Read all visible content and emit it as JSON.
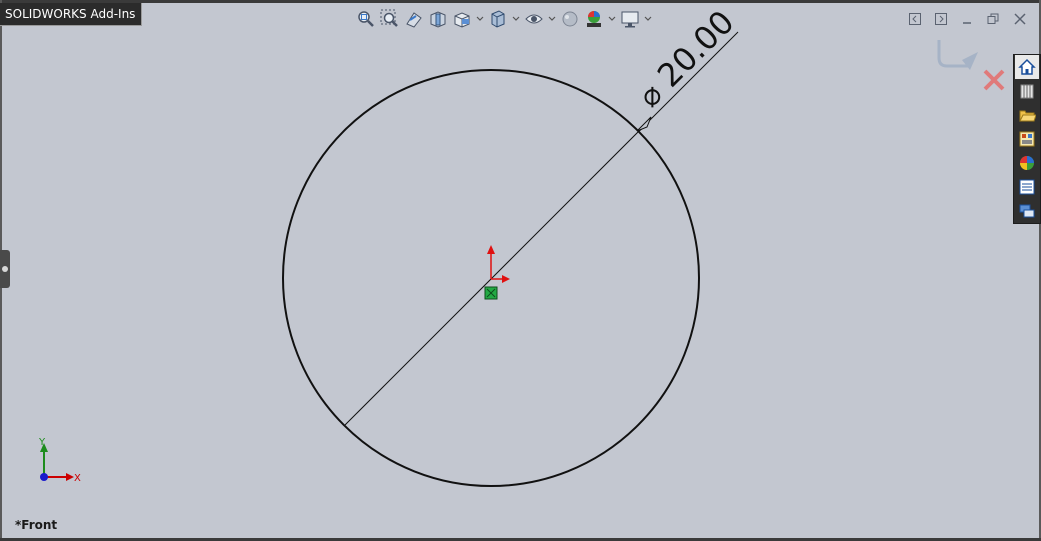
{
  "tab": {
    "label": "SOLIDWORKS Add-Ins"
  },
  "heads_up_toolbar": {
    "items": [
      {
        "name": "zoom-to-fit-icon"
      },
      {
        "name": "zoom-to-area-icon"
      },
      {
        "name": "previous-view-icon"
      },
      {
        "name": "section-view-icon"
      },
      {
        "name": "view-orientation-icon",
        "dropdown": true
      },
      {
        "name": "display-style-icon",
        "dropdown": true
      },
      {
        "name": "hide-show-items-icon",
        "dropdown": true
      },
      {
        "name": "edit-appearance-icon"
      },
      {
        "name": "apply-scene-icon",
        "dropdown": true
      },
      {
        "name": "view-settings-icon",
        "dropdown": true
      }
    ]
  },
  "window_controls": [
    "previous-viewport-icon",
    "next-viewport-icon",
    "minimize-icon",
    "restore-icon",
    "close-icon"
  ],
  "task_pane": {
    "items": [
      {
        "name": "solidworks-resources-icon",
        "active": true
      },
      {
        "name": "design-library-icon"
      },
      {
        "name": "file-explorer-icon"
      },
      {
        "name": "view-palette-icon"
      },
      {
        "name": "appearances-scenes-icon"
      },
      {
        "name": "custom-properties-icon"
      },
      {
        "name": "solidworks-forum-icon"
      }
    ]
  },
  "sketch": {
    "dimension_text": "20.00",
    "diameter_symbol": "⌀",
    "confirm_corner": {
      "exit_icon": "exit-sketch-icon",
      "cancel_icon": "cancel-sketch-icon"
    }
  },
  "triad": {
    "x_label": "X",
    "y_label": "Y",
    "x_color": "#cc0000",
    "y_color": "#1d8c1d",
    "z_color": "#1a1acc"
  },
  "view": {
    "label": "*Front"
  },
  "colors": {
    "background": "#c3c7d0",
    "origin_red": "#e01010",
    "sketch_point": "#22aa44"
  }
}
